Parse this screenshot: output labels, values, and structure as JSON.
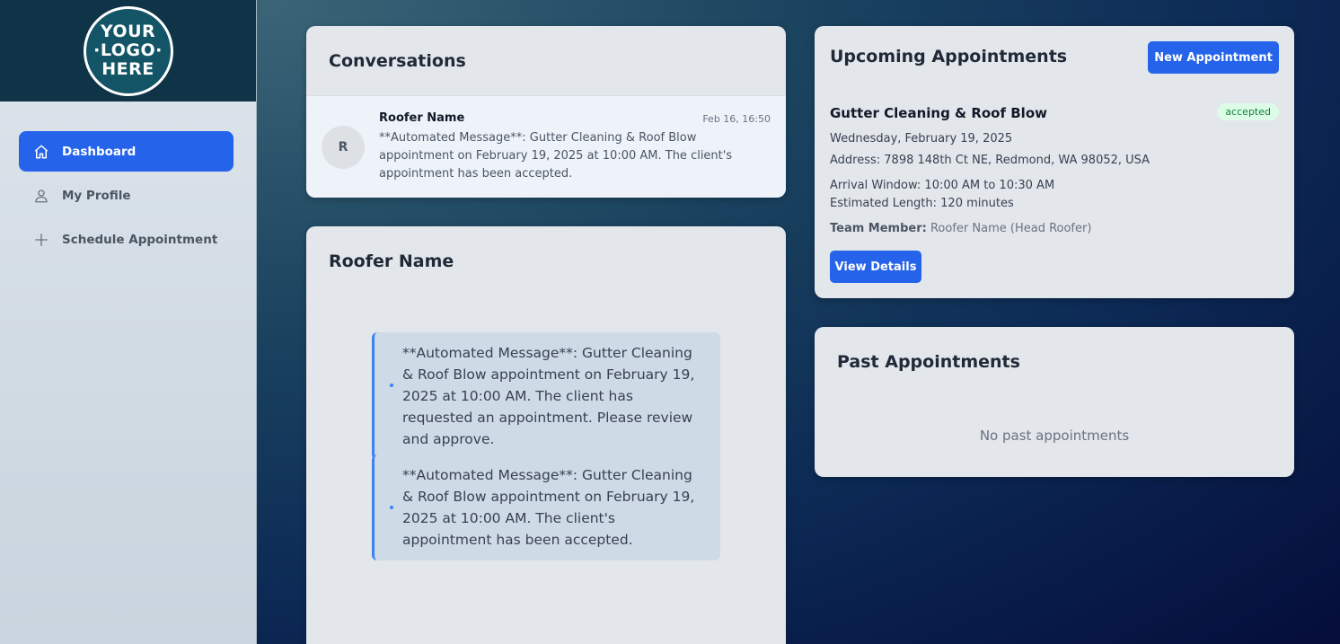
{
  "logo": {
    "lines": [
      "YOUR",
      "·LOGO·",
      "HERE"
    ]
  },
  "sidebar": {
    "items": [
      {
        "label": "Dashboard",
        "icon": "home-icon",
        "active": true
      },
      {
        "label": "My Profile",
        "icon": "user-icon",
        "active": false
      },
      {
        "label": "Schedule Appointment",
        "icon": "plus-icon",
        "active": false
      }
    ]
  },
  "conversations": {
    "title": "Conversations",
    "items": [
      {
        "avatar_initial": "R",
        "name": "Roofer Name",
        "time": "Feb 16, 16:50",
        "preview": "**Automated Message**: Gutter Cleaning & Roof Blow appointment on February 19, 2025 at 10:00 AM. The client's appointment has been accepted."
      }
    ]
  },
  "chat": {
    "title": "Roofer Name",
    "messages": [
      {
        "text": "**Automated Message**: Gutter Cleaning & Roof Blow appointment on February 19, 2025 at 10:00 AM. The client has requested an appointment. Please review and approve."
      },
      {
        "text": "**Automated Message**: Gutter Cleaning & Roof Blow appointment on February 19, 2025 at 10:00 AM. The client's appointment has been accepted."
      }
    ]
  },
  "upcoming": {
    "title": "Upcoming Appointments",
    "new_button": "New Appointment",
    "appointment": {
      "service": "Gutter Cleaning & Roof Blow",
      "status": "accepted",
      "date": "Wednesday, February 19, 2025",
      "address": "Address: 7898 148th Ct NE, Redmond, WA 98052, USA",
      "arrival": "Arrival Window: 10:00 AM to 10:30 AM",
      "length": "Estimated Length: 120 minutes",
      "team_label": "Team Member:",
      "team_value": "Roofer Name (Head Roofer)",
      "details_button": "View Details"
    }
  },
  "past": {
    "title": "Past Appointments",
    "empty": "No past appointments"
  },
  "colors": {
    "accent": "#2563eb",
    "status_accepted_bg": "#dcfce7",
    "status_accepted_text": "#15803d"
  }
}
